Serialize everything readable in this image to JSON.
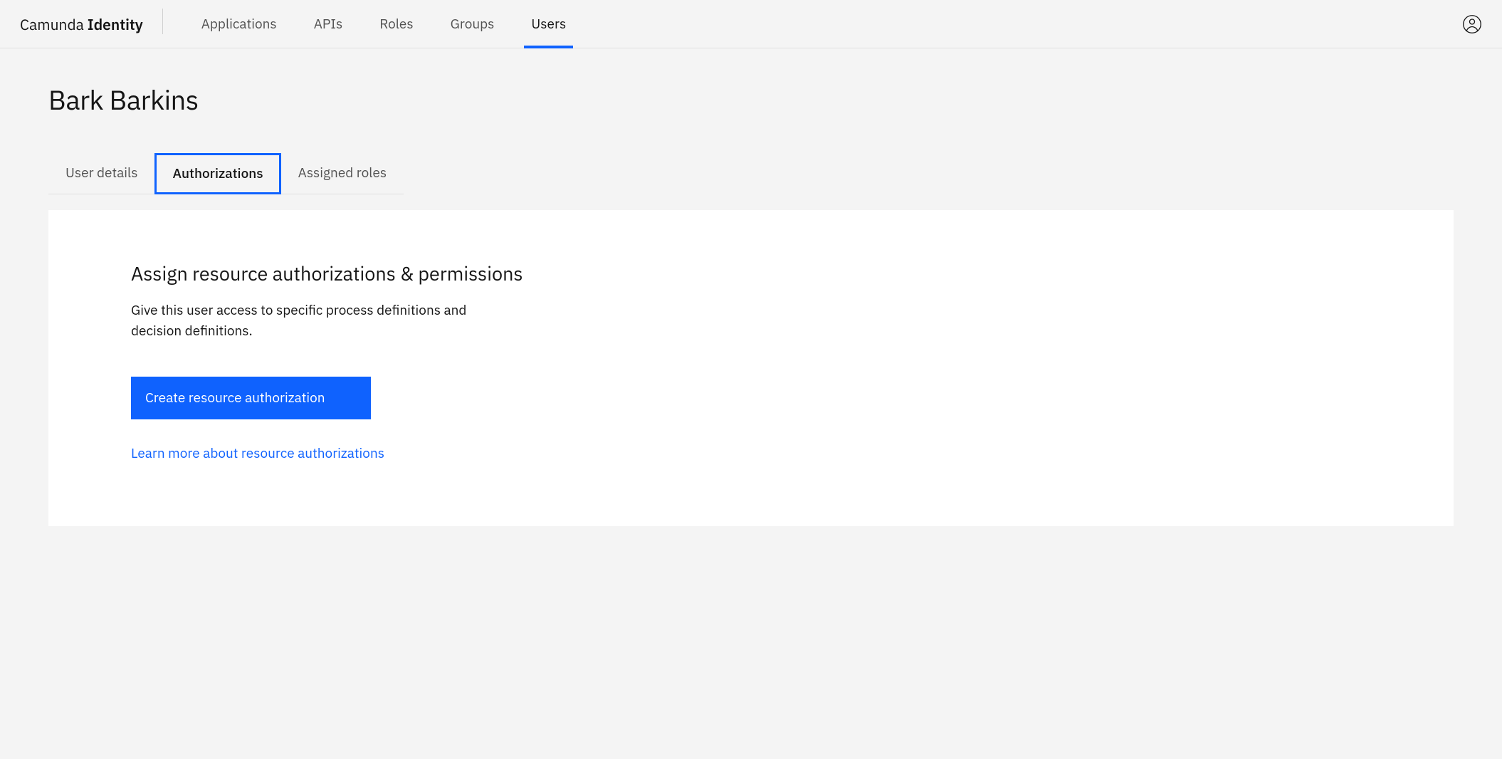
{
  "brand": {
    "light": "Camunda ",
    "bold": "Identity"
  },
  "nav": {
    "items": [
      {
        "label": "Applications",
        "active": false
      },
      {
        "label": "APIs",
        "active": false
      },
      {
        "label": "Roles",
        "active": false
      },
      {
        "label": "Groups",
        "active": false
      },
      {
        "label": "Users",
        "active": true
      }
    ]
  },
  "page": {
    "title": "Bark Barkins"
  },
  "tabs": [
    {
      "label": "User details",
      "active": false
    },
    {
      "label": "Authorizations",
      "active": true
    },
    {
      "label": "Assigned roles",
      "active": false
    }
  ],
  "panel": {
    "heading": "Assign resource authorizations & permissions",
    "description": "Give this user access to specific process definitions and decision definitions.",
    "button_label": "Create resource authorization",
    "link_label": "Learn more about resource authorizations"
  }
}
